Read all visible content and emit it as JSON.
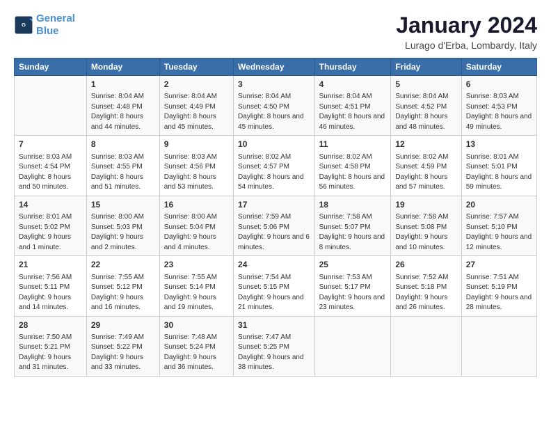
{
  "header": {
    "logo_line1": "General",
    "logo_line2": "Blue",
    "title": "January 2024",
    "subtitle": "Lurago d'Erba, Lombardy, Italy"
  },
  "days_of_week": [
    "Sunday",
    "Monday",
    "Tuesday",
    "Wednesday",
    "Thursday",
    "Friday",
    "Saturday"
  ],
  "weeks": [
    [
      {
        "day": "",
        "sunrise": "",
        "sunset": "",
        "daylight": ""
      },
      {
        "day": "1",
        "sunrise": "Sunrise: 8:04 AM",
        "sunset": "Sunset: 4:48 PM",
        "daylight": "Daylight: 8 hours and 44 minutes."
      },
      {
        "day": "2",
        "sunrise": "Sunrise: 8:04 AM",
        "sunset": "Sunset: 4:49 PM",
        "daylight": "Daylight: 8 hours and 45 minutes."
      },
      {
        "day": "3",
        "sunrise": "Sunrise: 8:04 AM",
        "sunset": "Sunset: 4:50 PM",
        "daylight": "Daylight: 8 hours and 45 minutes."
      },
      {
        "day": "4",
        "sunrise": "Sunrise: 8:04 AM",
        "sunset": "Sunset: 4:51 PM",
        "daylight": "Daylight: 8 hours and 46 minutes."
      },
      {
        "day": "5",
        "sunrise": "Sunrise: 8:04 AM",
        "sunset": "Sunset: 4:52 PM",
        "daylight": "Daylight: 8 hours and 48 minutes."
      },
      {
        "day": "6",
        "sunrise": "Sunrise: 8:03 AM",
        "sunset": "Sunset: 4:53 PM",
        "daylight": "Daylight: 8 hours and 49 minutes."
      }
    ],
    [
      {
        "day": "7",
        "sunrise": "Sunrise: 8:03 AM",
        "sunset": "Sunset: 4:54 PM",
        "daylight": "Daylight: 8 hours and 50 minutes."
      },
      {
        "day": "8",
        "sunrise": "Sunrise: 8:03 AM",
        "sunset": "Sunset: 4:55 PM",
        "daylight": "Daylight: 8 hours and 51 minutes."
      },
      {
        "day": "9",
        "sunrise": "Sunrise: 8:03 AM",
        "sunset": "Sunset: 4:56 PM",
        "daylight": "Daylight: 8 hours and 53 minutes."
      },
      {
        "day": "10",
        "sunrise": "Sunrise: 8:02 AM",
        "sunset": "Sunset: 4:57 PM",
        "daylight": "Daylight: 8 hours and 54 minutes."
      },
      {
        "day": "11",
        "sunrise": "Sunrise: 8:02 AM",
        "sunset": "Sunset: 4:58 PM",
        "daylight": "Daylight: 8 hours and 56 minutes."
      },
      {
        "day": "12",
        "sunrise": "Sunrise: 8:02 AM",
        "sunset": "Sunset: 4:59 PM",
        "daylight": "Daylight: 8 hours and 57 minutes."
      },
      {
        "day": "13",
        "sunrise": "Sunrise: 8:01 AM",
        "sunset": "Sunset: 5:01 PM",
        "daylight": "Daylight: 8 hours and 59 minutes."
      }
    ],
    [
      {
        "day": "14",
        "sunrise": "Sunrise: 8:01 AM",
        "sunset": "Sunset: 5:02 PM",
        "daylight": "Daylight: 9 hours and 1 minute."
      },
      {
        "day": "15",
        "sunrise": "Sunrise: 8:00 AM",
        "sunset": "Sunset: 5:03 PM",
        "daylight": "Daylight: 9 hours and 2 minutes."
      },
      {
        "day": "16",
        "sunrise": "Sunrise: 8:00 AM",
        "sunset": "Sunset: 5:04 PM",
        "daylight": "Daylight: 9 hours and 4 minutes."
      },
      {
        "day": "17",
        "sunrise": "Sunrise: 7:59 AM",
        "sunset": "Sunset: 5:06 PM",
        "daylight": "Daylight: 9 hours and 6 minutes."
      },
      {
        "day": "18",
        "sunrise": "Sunrise: 7:58 AM",
        "sunset": "Sunset: 5:07 PM",
        "daylight": "Daylight: 9 hours and 8 minutes."
      },
      {
        "day": "19",
        "sunrise": "Sunrise: 7:58 AM",
        "sunset": "Sunset: 5:08 PM",
        "daylight": "Daylight: 9 hours and 10 minutes."
      },
      {
        "day": "20",
        "sunrise": "Sunrise: 7:57 AM",
        "sunset": "Sunset: 5:10 PM",
        "daylight": "Daylight: 9 hours and 12 minutes."
      }
    ],
    [
      {
        "day": "21",
        "sunrise": "Sunrise: 7:56 AM",
        "sunset": "Sunset: 5:11 PM",
        "daylight": "Daylight: 9 hours and 14 minutes."
      },
      {
        "day": "22",
        "sunrise": "Sunrise: 7:55 AM",
        "sunset": "Sunset: 5:12 PM",
        "daylight": "Daylight: 9 hours and 16 minutes."
      },
      {
        "day": "23",
        "sunrise": "Sunrise: 7:55 AM",
        "sunset": "Sunset: 5:14 PM",
        "daylight": "Daylight: 9 hours and 19 minutes."
      },
      {
        "day": "24",
        "sunrise": "Sunrise: 7:54 AM",
        "sunset": "Sunset: 5:15 PM",
        "daylight": "Daylight: 9 hours and 21 minutes."
      },
      {
        "day": "25",
        "sunrise": "Sunrise: 7:53 AM",
        "sunset": "Sunset: 5:17 PM",
        "daylight": "Daylight: 9 hours and 23 minutes."
      },
      {
        "day": "26",
        "sunrise": "Sunrise: 7:52 AM",
        "sunset": "Sunset: 5:18 PM",
        "daylight": "Daylight: 9 hours and 26 minutes."
      },
      {
        "day": "27",
        "sunrise": "Sunrise: 7:51 AM",
        "sunset": "Sunset: 5:19 PM",
        "daylight": "Daylight: 9 hours and 28 minutes."
      }
    ],
    [
      {
        "day": "28",
        "sunrise": "Sunrise: 7:50 AM",
        "sunset": "Sunset: 5:21 PM",
        "daylight": "Daylight: 9 hours and 31 minutes."
      },
      {
        "day": "29",
        "sunrise": "Sunrise: 7:49 AM",
        "sunset": "Sunset: 5:22 PM",
        "daylight": "Daylight: 9 hours and 33 minutes."
      },
      {
        "day": "30",
        "sunrise": "Sunrise: 7:48 AM",
        "sunset": "Sunset: 5:24 PM",
        "daylight": "Daylight: 9 hours and 36 minutes."
      },
      {
        "day": "31",
        "sunrise": "Sunrise: 7:47 AM",
        "sunset": "Sunset: 5:25 PM",
        "daylight": "Daylight: 9 hours and 38 minutes."
      },
      {
        "day": "",
        "sunrise": "",
        "sunset": "",
        "daylight": ""
      },
      {
        "day": "",
        "sunrise": "",
        "sunset": "",
        "daylight": ""
      },
      {
        "day": "",
        "sunrise": "",
        "sunset": "",
        "daylight": ""
      }
    ]
  ]
}
